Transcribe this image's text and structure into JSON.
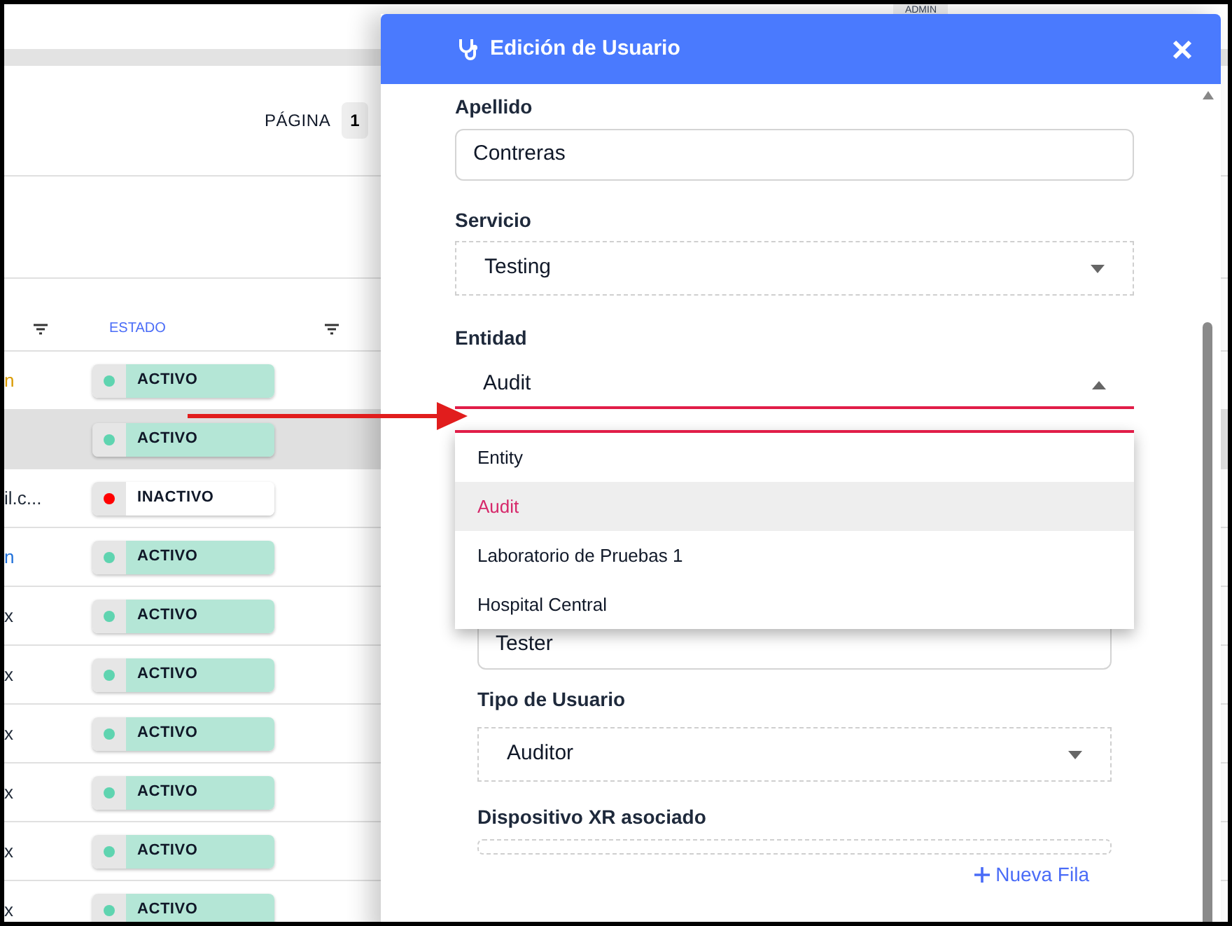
{
  "top_badge": "ADMIN",
  "pagination": {
    "label": "PÁGINA",
    "page": "1"
  },
  "table": {
    "columns": [
      {
        "label": "ESTADO"
      }
    ],
    "rows": [
      {
        "cell_1": "n",
        "color": "#d99a00",
        "status": "ACTIVO",
        "active": true,
        "selected": false
      },
      {
        "status": "ACTIVO",
        "active": true,
        "selected": true
      },
      {
        "cell_1": "il.c...",
        "color": "#1f2937",
        "status": "INACTIVO",
        "active": false,
        "selected": false
      },
      {
        "cell_1": "n",
        "color": "#1e6fd9",
        "status": "ACTIVO",
        "active": true,
        "selected": false
      },
      {
        "cell_1": "x",
        "color": "#1f2937",
        "status": "ACTIVO",
        "active": true,
        "selected": false
      },
      {
        "cell_1": "x",
        "color": "#1f2937",
        "status": "ACTIVO",
        "active": true,
        "selected": false
      },
      {
        "cell_1": "x",
        "color": "#1f2937",
        "status": "ACTIVO",
        "active": true,
        "selected": false
      },
      {
        "cell_1": "x",
        "color": "#1f2937",
        "status": "ACTIVO",
        "active": true,
        "selected": false
      },
      {
        "cell_1": "x",
        "color": "#1f2937",
        "status": "ACTIVO",
        "active": true,
        "selected": false
      },
      {
        "cell_1": "x",
        "color": "#1f2937",
        "status": "ACTIVO",
        "active": true,
        "selected": false
      }
    ]
  },
  "modal": {
    "title": "Edición de Usuario",
    "apellido": {
      "label": "Apellido",
      "value": "Contreras"
    },
    "servicio": {
      "label": "Servicio",
      "value": "Testing"
    },
    "entidad": {
      "label": "Entidad",
      "value": "Audit",
      "expanded": true,
      "options": [
        {
          "label": "Entity",
          "selected": false
        },
        {
          "label": "Audit",
          "selected": true
        },
        {
          "label": "Laboratorio de Pruebas 1",
          "selected": false
        },
        {
          "label": "Hospital Central",
          "selected": false
        }
      ]
    },
    "cargo": {
      "value": "Tester"
    },
    "tipo": {
      "label": "Tipo de Usuario",
      "value": "Auditor"
    },
    "dispositivo": {
      "label": "Dispositivo XR asociado",
      "add_button": "Nueva Fila"
    }
  }
}
